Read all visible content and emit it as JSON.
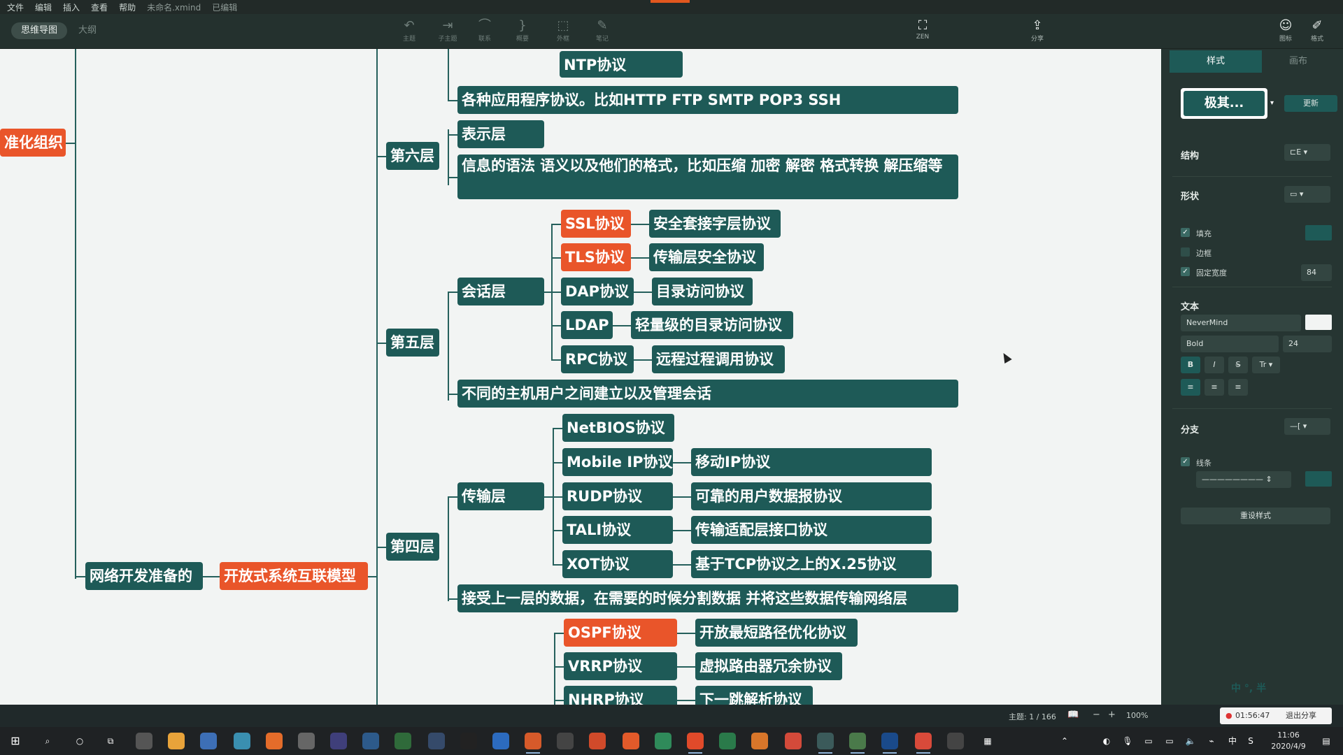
{
  "menubar": {
    "items": [
      "文件",
      "编辑",
      "插入",
      "查看",
      "帮助"
    ],
    "filename": "未命名.xmind",
    "status": "已编辑"
  },
  "toolbar": {
    "mode_mindmap": "思维导图",
    "mode_outline": "大纲",
    "tools": [
      "主题",
      "子主题",
      "联系",
      "概要",
      "外框",
      "笔记"
    ],
    "zen": "ZEN",
    "share": "分享",
    "icons_label": "图标",
    "format_label": "格式"
  },
  "mindmap": {
    "root_partial": "准化组织",
    "central_prefix": "网络开发准备的",
    "central": "开放式系统互联模型",
    "layer6": {
      "label": "第六层",
      "ntp": "NTP协议",
      "apps": "各种应用程序协议。比如HTTP  FTP  SMTP POP3 SSH",
      "presentation": "表示层",
      "presentation_desc": "信息的语法 语义以及他们的格式，比如压缩 加密 解密 格式转换  解压缩等"
    },
    "layer5": {
      "label": "第五层",
      "session": "会话层",
      "protocols": [
        {
          "name": "SSL协议",
          "desc": "安全套接字层协议",
          "highlight": true
        },
        {
          "name": "TLS协议",
          "desc": "传输层安全协议",
          "highlight": true
        },
        {
          "name": "DAP协议",
          "desc": "目录访问协议",
          "highlight": false
        },
        {
          "name": "LDAP",
          "desc": "轻量级的目录访问协议",
          "highlight": false
        },
        {
          "name": "RPC协议",
          "desc": "远程过程调用协议",
          "highlight": false
        }
      ],
      "desc": "不同的主机用户之间建立以及管理会话"
    },
    "layer4": {
      "label": "第四层",
      "transport": "传输层",
      "protocols": [
        {
          "name": "NetBIOS协议",
          "desc": ""
        },
        {
          "name": "Mobile IP协议",
          "desc": "移动IP协议"
        },
        {
          "name": "RUDP协议",
          "desc": "可靠的用户数据报协议"
        },
        {
          "name": "TALI协议",
          "desc": "传输适配层接口协议"
        },
        {
          "name": "XOT协议",
          "desc": "基于TCP协议之上的X.25协议"
        }
      ],
      "desc": "接受上一层的数据，在需要的时候分割数据 并将这些数据传输网络层"
    },
    "layer3": {
      "protocols": [
        {
          "name": "OSPF协议",
          "desc": "开放最短路径优化协议",
          "highlight": true
        },
        {
          "name": "VRRP协议",
          "desc": "虚拟路由器冗余协议",
          "highlight": false
        },
        {
          "name": "NHRP协议",
          "desc": "下一跳解析协议",
          "highlight": false
        }
      ]
    }
  },
  "panel": {
    "tab_style": "样式",
    "tab_canvas": "画布",
    "style_name": "极其...",
    "update": "更新",
    "structure": "结构",
    "shape": "形状",
    "fill": "填充",
    "border": "边框",
    "fixed_width": "固定宽度",
    "fixed_width_value": "84",
    "text": "文本",
    "font": "NeverMind",
    "weight": "Bold",
    "size": "24",
    "branch": "分支",
    "line": "线条",
    "reset": "重设样式",
    "colors": {
      "fill": "#1e5a57",
      "text": "#ffffff"
    }
  },
  "statusbar": {
    "topics": "主题: 1 / 166",
    "zoom": "100%",
    "timer": "01:56:47",
    "exit_share": "退出分享"
  },
  "taskbar": {
    "time": "11:06",
    "date": "2020/4/9",
    "ime": "中 °, 半"
  }
}
